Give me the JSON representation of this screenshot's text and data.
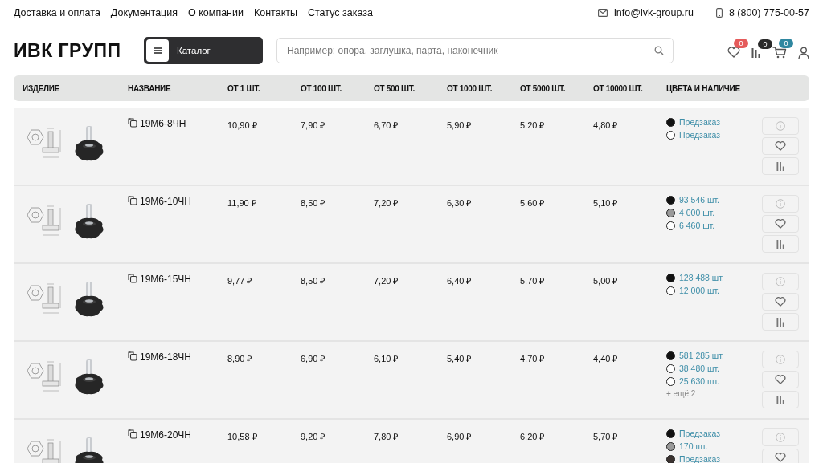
{
  "top_links": [
    "Доставка и оплата",
    "Документация",
    "О компании",
    "Контакты",
    "Статус заказа"
  ],
  "contacts": {
    "email": "info@ivk-group.ru",
    "phone": "8 (800) 775-00-57"
  },
  "logo": "ИВК ГРУПП",
  "catalog_button": "Каталог",
  "search": {
    "placeholder": "Например: опора, заглушка, парта, наконечник"
  },
  "header_counters": {
    "favorites": "0",
    "compare": "0",
    "cart": "0"
  },
  "table": {
    "columns": [
      "ИЗДЕЛИЕ",
      "НАЗВАНИЕ",
      "ОТ 1 ШТ.",
      "ОТ 100 ШТ.",
      "ОТ 500 ШТ.",
      "ОТ 1000 ШТ.",
      "ОТ 5000 ШТ.",
      "ОТ 10000 ШТ.",
      "ЦВЕТА И НАЛИЧИЕ"
    ],
    "rows": [
      {
        "name": "19М6-8ЧН",
        "prices": [
          "10,90 ₽",
          "7,90 ₽",
          "6,70 ₽",
          "5,90 ₽",
          "5,20 ₽",
          "4,80 ₽"
        ],
        "colors": [
          {
            "color": "#111111",
            "stock": "Предзаказ"
          },
          {
            "color": "#ffffff",
            "stock": "Предзаказ"
          }
        ]
      },
      {
        "name": "19М6-10ЧН",
        "prices": [
          "11,90 ₽",
          "8,50 ₽",
          "7,20 ₽",
          "6,30 ₽",
          "5,60 ₽",
          "5,10 ₽"
        ],
        "colors": [
          {
            "color": "#111111",
            "stock": "93 546 шт."
          },
          {
            "color": "#9a9a9a",
            "stock": "4 000 шт."
          },
          {
            "color": "#ffffff",
            "stock": "6 460 шт."
          }
        ]
      },
      {
        "name": "19М6-15ЧН",
        "prices": [
          "9,77 ₽",
          "8,50 ₽",
          "7,20 ₽",
          "6,40 ₽",
          "5,70 ₽",
          "5,00 ₽"
        ],
        "colors": [
          {
            "color": "#111111",
            "stock": "128 488 шт."
          },
          {
            "color": "#ffffff",
            "stock": "12 000 шт."
          }
        ]
      },
      {
        "name": "19М6-18ЧН",
        "prices": [
          "8,90 ₽",
          "6,90 ₽",
          "6,10 ₽",
          "5,40 ₽",
          "4,70 ₽",
          "4,40 ₽"
        ],
        "colors": [
          {
            "color": "#111111",
            "stock": "581 285 шт."
          },
          {
            "color": "#ffffff",
            "stock": "38 480 шт."
          },
          {
            "color": "#ffffff",
            "stock": "25 630 шт."
          }
        ],
        "more": "+ ещё 2"
      },
      {
        "name": "19М6-20ЧН",
        "prices": [
          "10,58 ₽",
          "9,20 ₽",
          "7,80 ₽",
          "6,90 ₽",
          "6,20 ₽",
          "5,70 ₽"
        ],
        "colors": [
          {
            "color": "#111111",
            "stock": "Предзаказ"
          },
          {
            "color": "#9a9a9a",
            "stock": "170 шт."
          },
          {
            "color": "#3b3330",
            "stock": "Предзаказ"
          }
        ]
      }
    ]
  }
}
